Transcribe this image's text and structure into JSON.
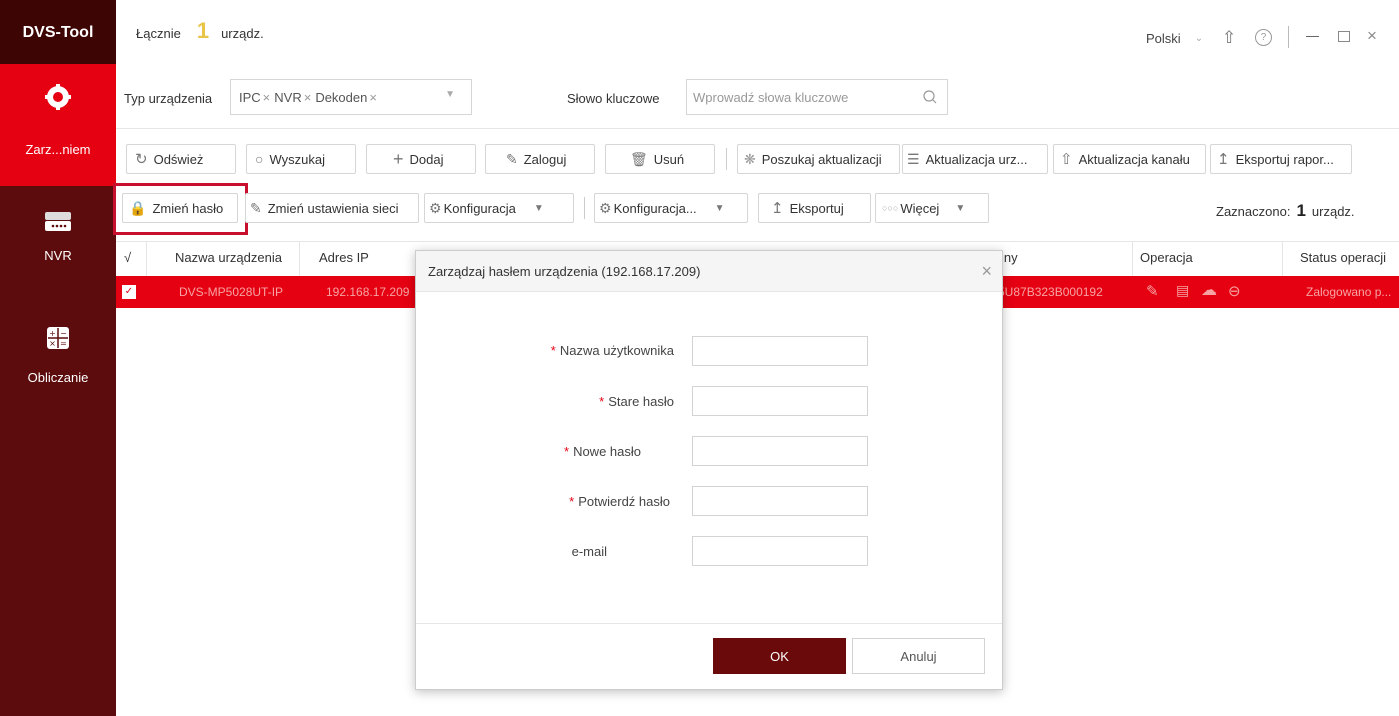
{
  "app": {
    "title": "DVS-Tool"
  },
  "sidebar": {
    "items": [
      {
        "label": "Zarz...niem",
        "icon": "gear-icon"
      },
      {
        "label": "NVR",
        "icon": "nvr-device-icon"
      },
      {
        "label": "Obliczanie",
        "icon": "calculator-icon"
      }
    ]
  },
  "header": {
    "total_label": "Łącznie",
    "total_count": "1",
    "total_unit": "urządz.",
    "language": "Polski"
  },
  "filters": {
    "device_type_label": "Typ urządzenia",
    "device_type_tags": [
      "IPC",
      "NVR",
      "Dekoden"
    ],
    "keyword_label": "Słowo kluczowe",
    "keyword_placeholder": "Wprowadź słowa kluczowe"
  },
  "toolbar1": {
    "refresh": "Odśwież",
    "search": "Wyszukaj",
    "add": "Dodaj",
    "login": "Zaloguj",
    "delete": "Usuń",
    "check_update": "Poszukaj aktualizacji",
    "update_device": "Aktualizacja urz...",
    "update_channel": "Aktualizacja kanału",
    "export_report": "Eksportuj rapor..."
  },
  "toolbar2": {
    "change_password": "Zmień hasło",
    "change_network": "Zmień ustawienia sieci",
    "config1": "Konfiguracja",
    "config2": "Konfiguracja...",
    "export": "Eksportuj",
    "more": "Więcej",
    "selected_label": "Zaznaczono:",
    "selected_count": "1",
    "selected_unit": "urządz."
  },
  "table": {
    "headers": {
      "check": "√",
      "name": "Nazwa urządzenia",
      "ip": "Adres IP",
      "serial": "jny",
      "operation": "Operacja",
      "status": "Status operacji"
    },
    "row": {
      "name": "DVS-MP5028UT-IP",
      "ip": "192.168.17.209",
      "serial": "5U87B323B000192",
      "status": "Zalogowano p..."
    }
  },
  "dialog": {
    "title": "Zarządzaj hasłem urządzenia (192.168.17.209)",
    "fields": [
      {
        "label": "Nazwa użytkownika",
        "required": "*"
      },
      {
        "label": "Stare hasło",
        "required": "*"
      },
      {
        "label": "Nowe hasło",
        "required": "*"
      },
      {
        "label": "Potwierdź hasło",
        "required": "*"
      },
      {
        "label": "e-mail",
        "required": ""
      }
    ],
    "ok": "OK",
    "cancel": "Anuluj"
  },
  "colors": {
    "brand_red": "#e50012",
    "sidebar": "#5c0c0c",
    "ok_button": "#6b0a0a",
    "highlight_box": "#c8102e"
  }
}
